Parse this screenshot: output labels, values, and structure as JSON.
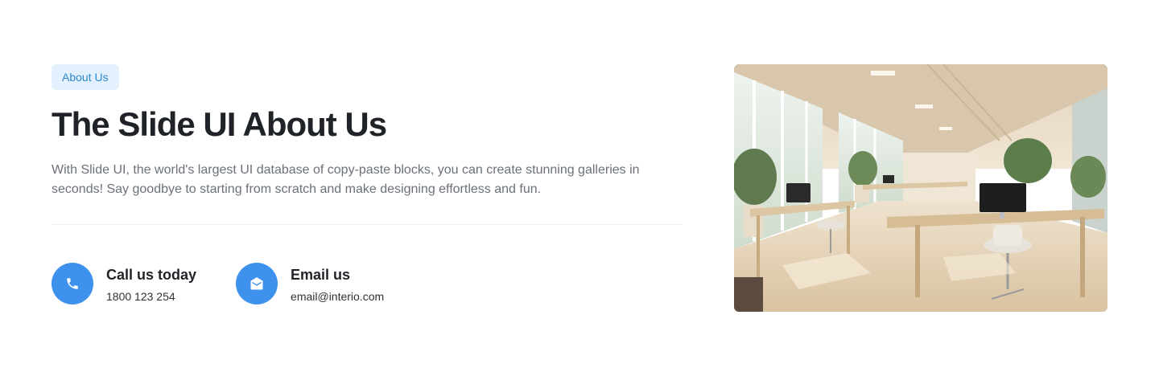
{
  "badge": "About Us",
  "title": "The Slide UI About Us",
  "description": "With Slide UI, the world's largest UI database of copy-paste blocks, you can create stunning galleries in seconds! Say goodbye to starting from scratch and make designing effortless and fun.",
  "contacts": [
    {
      "title": "Call us today",
      "value": "1800 123 254",
      "icon": "phone-icon"
    },
    {
      "title": "Email us",
      "value": "email@interio.com",
      "icon": "envelope-icon"
    }
  ],
  "image": {
    "subject": "office-interior-photo"
  },
  "colors": {
    "accent": "#3f91ee",
    "badge_bg": "#e3f1fe",
    "badge_text": "#2b8ad0",
    "heading": "#1f2328",
    "body_text": "#6b7079"
  }
}
